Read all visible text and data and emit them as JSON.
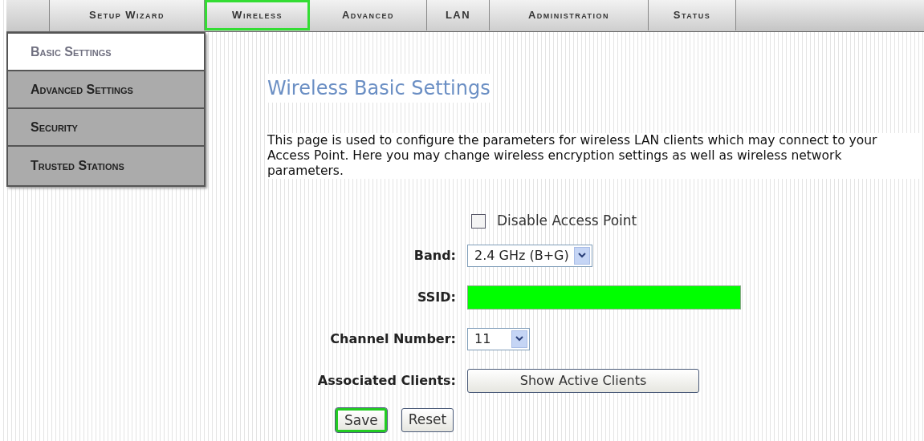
{
  "tabs": [
    {
      "label": "Setup Wizard",
      "selected": false
    },
    {
      "label": "Wireless",
      "selected": true
    },
    {
      "label": "Advanced",
      "selected": false
    },
    {
      "label": "LAN",
      "selected": false
    },
    {
      "label": "Administration",
      "selected": false
    },
    {
      "label": "Status",
      "selected": false
    }
  ],
  "sidebar": {
    "items": [
      {
        "label": "Basic Settings",
        "selected": true
      },
      {
        "label": "Advanced Settings",
        "selected": false
      },
      {
        "label": "Security",
        "selected": false
      },
      {
        "label": "Trusted Stations",
        "selected": false
      }
    ]
  },
  "title": "Wireless Basic Settings",
  "description": "This page is used to configure the parameters for wireless LAN clients which may connect to your Access Point. Here you may change wireless encryption settings as well as wireless network parameters.",
  "disable_access_point": {
    "label": "Disable Access Point",
    "checked": false
  },
  "fields": [
    {
      "kind": "select",
      "label": "Band:",
      "value": "2.4 GHz (B+G)"
    },
    {
      "kind": "masked",
      "label": "SSID:"
    },
    {
      "kind": "select",
      "label": "Channel Number:",
      "value": "11"
    },
    {
      "kind": "button",
      "label": "Associated Clients:",
      "value": "Show Active Clients"
    }
  ],
  "buttons": [
    {
      "label": "Save",
      "highlighted": true
    },
    {
      "label": "Reset",
      "highlighted": false
    }
  ]
}
